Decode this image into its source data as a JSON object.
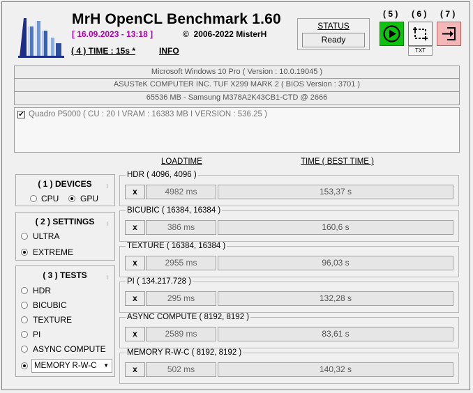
{
  "header": {
    "title": "MrH OpenCL Benchmark 1.60",
    "date": "[ 16.09.2023 - 13:18 ]",
    "copyright": "2006-2022 MisterH",
    "time": "( 4 ) TIME : 15s *",
    "info": "INFO"
  },
  "status": {
    "label": "STATUS",
    "value": "Ready"
  },
  "toolbar": {
    "run_num": "( 5 )",
    "screenshot_num": "( 6 )",
    "exit_num": "( 7 )",
    "txt_label": "TXT"
  },
  "system": {
    "os": "Microsoft Windows 10 Pro ( Version : 10.0.19045 )",
    "board": "ASUSTeK COMPUTER INC. TUF X299 MARK 2 ( BIOS Version : 3701 )",
    "memory": "65536 MB - Samsung M378A2K43CB1-CTD     @ 2666"
  },
  "gpu": {
    "text": "Quadro P5000 ( CU : 20 I VRAM : 16383 MB I VERSION : 536.25 )",
    "checked": true
  },
  "columns": {
    "loadtime": "LOADTIME",
    "time": "TIME ( BEST TIME )"
  },
  "devices": {
    "title": "( 1 ) DEVICES",
    "cpu": "CPU",
    "gpu": "GPU",
    "selected": "GPU"
  },
  "settings": {
    "title": "( 2 ) SETTINGS",
    "ultra": "ULTRA",
    "extreme": "EXTREME",
    "selected": "EXTREME"
  },
  "tests": {
    "title": "( 3 ) TESTS",
    "items": [
      "HDR",
      "BICUBIC",
      "TEXTURE",
      "PI",
      "ASYNC COMPUTE"
    ],
    "selected": "MEMORY R-W-C"
  },
  "benchmarks": [
    {
      "title": "HDR ( 4096, 4096 )",
      "x": "x",
      "loadtime": "4982 ms",
      "time": "153,37 s"
    },
    {
      "title": "BICUBIC ( 16384, 16384 )",
      "x": "x",
      "loadtime": "386 ms",
      "time": "160,6 s"
    },
    {
      "title": "TEXTURE ( 16384, 16384 )",
      "x": "x",
      "loadtime": "2955 ms",
      "time": "96,03 s"
    },
    {
      "title": "PI ( 134.217.728 )",
      "x": "x",
      "loadtime": "295 ms",
      "time": "132,28 s"
    },
    {
      "title": "ASYNC COMPUTE ( 8192, 8192 )",
      "x": "x",
      "loadtime": "2589 ms",
      "time": "83,61 s"
    },
    {
      "title": "MEMORY R-W-C ( 8192, 8192 )",
      "x": "x",
      "loadtime": "502 ms",
      "time": "140,32 s"
    }
  ],
  "colors": {
    "run": "#0ec30e",
    "exit": "#f3b7b7",
    "date": "#b000b0"
  }
}
